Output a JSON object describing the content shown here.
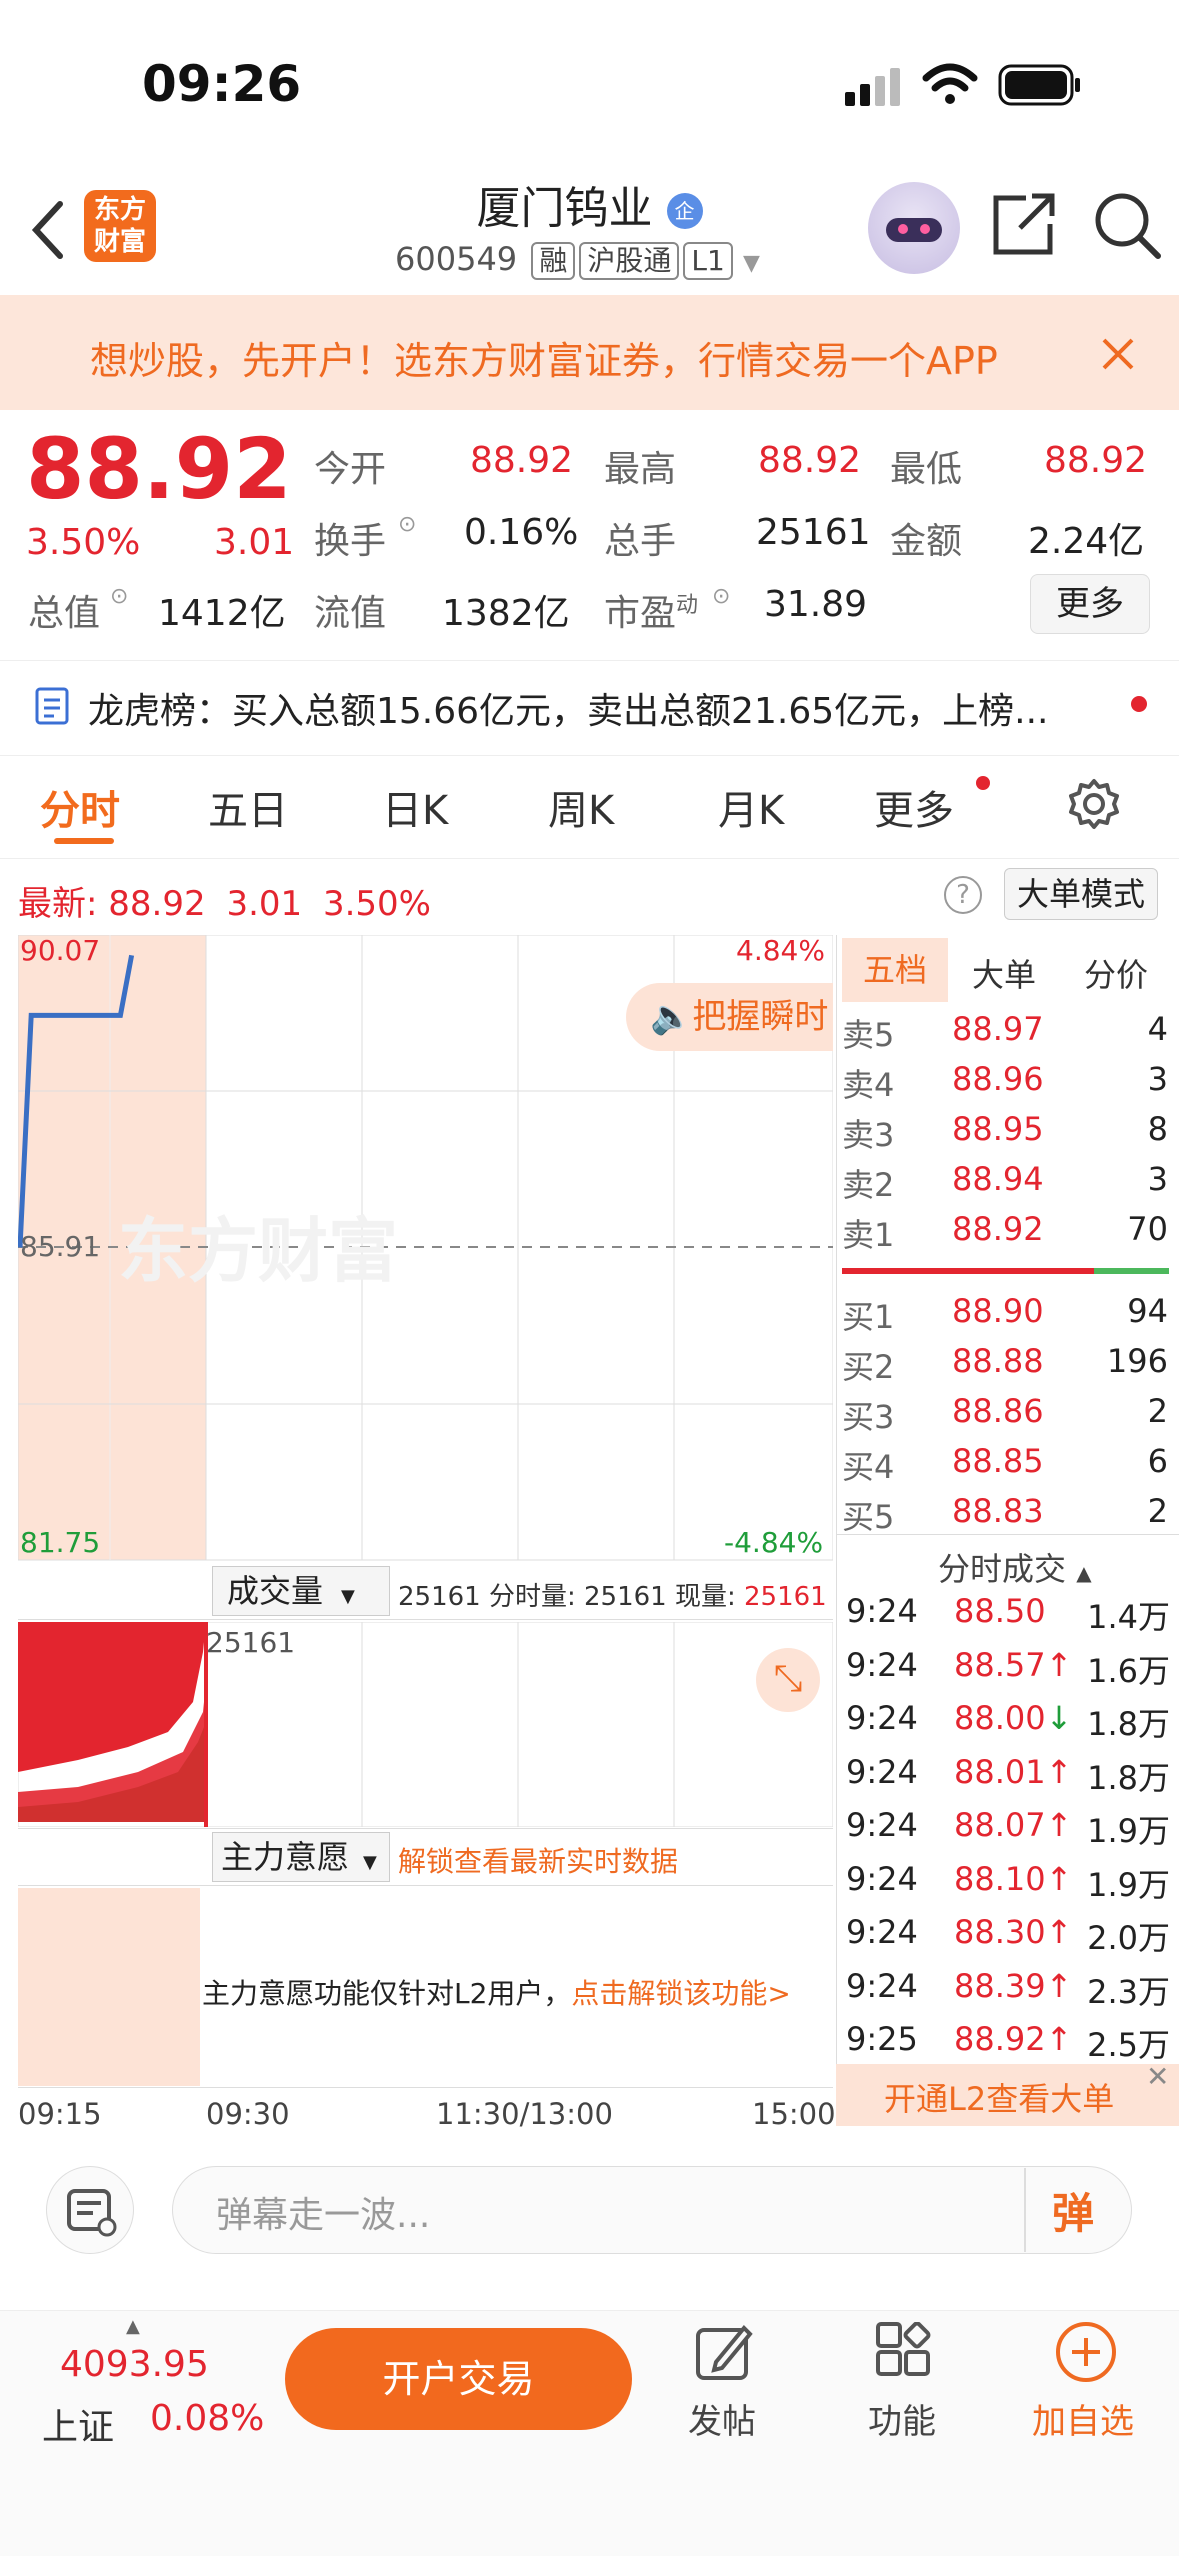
{
  "status_bar": {
    "time": "09:26"
  },
  "nav": {
    "logo_line1": "东方",
    "logo_line2": "财富",
    "title": "厦门钨业",
    "title_badge": "企",
    "code": "600549",
    "tags": [
      "融",
      "沪股通",
      "L1"
    ]
  },
  "banner": {
    "text": "想炒股，先开户！选东方财富证券，行情交易一个APP"
  },
  "quote": {
    "price": "88.92",
    "change_pct": "3.50%",
    "change": "3.01",
    "fields": [
      {
        "label": "今开",
        "value": "88.92"
      },
      {
        "label": "最高",
        "value": "88.92"
      },
      {
        "label": "最低",
        "value": "88.92"
      },
      {
        "label": "换手",
        "value": "0.16%"
      },
      {
        "label": "总手",
        "value": "25161"
      },
      {
        "label": "金额",
        "value": "2.24亿"
      },
      {
        "label": "总值",
        "value": "1412亿"
      },
      {
        "label": "流值",
        "value": "1382亿"
      },
      {
        "label": "市盈",
        "sup": "动",
        "value": "31.89"
      }
    ],
    "more_button": "更多"
  },
  "news": {
    "text": "龙虎榜：买入总额15.66亿元，卖出总额21.65亿元，上榜..."
  },
  "tabs": [
    "分时",
    "五日",
    "日K",
    "周K",
    "月K",
    "更多"
  ],
  "latest": {
    "label": "最新:",
    "price": "88.92",
    "change": "3.01",
    "pct": "3.50%",
    "big_order_mode": "大单模式"
  },
  "chart": {
    "y_top": "90.07",
    "y_mid": "85.91",
    "y_bottom": "81.75",
    "pct_top": "4.84%",
    "pct_bottom": "-4.84%",
    "watermark": "东方财富",
    "tip": "把握瞬时",
    "volume_selector": "成交量",
    "volume_info": "25161 分时量: 25161 现量:",
    "volume_now": "25161",
    "volume_axis": "25161",
    "intent_selector": "主力意愿",
    "intent_unlock": "解锁查看最新实时数据",
    "intent_msg": "主力意愿功能仅针对L2用户，",
    "intent_link": "点击解锁该功能>",
    "time_labels": [
      "09:15",
      "09:30",
      "11:30/13:00",
      "15:00"
    ]
  },
  "chart_data": {
    "type": "line",
    "x": [
      "09:15",
      "09:16",
      "09:17",
      "09:18",
      "09:19",
      "09:20",
      "09:21",
      "09:22",
      "09:23",
      "09:24",
      "09:25"
    ],
    "values": [
      85.91,
      89.0,
      89.0,
      89.0,
      89.0,
      89.0,
      89.0,
      89.0,
      89.0,
      89.0,
      89.8
    ],
    "ylim": [
      81.75,
      90.07
    ]
  },
  "orderbook": {
    "tabs": [
      "五档",
      "大单",
      "分价"
    ],
    "sells": [
      {
        "label": "卖5",
        "price": "88.97",
        "vol": "4"
      },
      {
        "label": "卖4",
        "price": "88.96",
        "vol": "3"
      },
      {
        "label": "卖3",
        "price": "88.95",
        "vol": "8"
      },
      {
        "label": "卖2",
        "price": "88.94",
        "vol": "3"
      },
      {
        "label": "卖1",
        "price": "88.92",
        "vol": "70"
      }
    ],
    "buys": [
      {
        "label": "买1",
        "price": "88.90",
        "vol": "94"
      },
      {
        "label": "买2",
        "price": "88.88",
        "vol": "196"
      },
      {
        "label": "买3",
        "price": "88.86",
        "vol": "2"
      },
      {
        "label": "买4",
        "price": "88.85",
        "vol": "6"
      },
      {
        "label": "买5",
        "price": "88.83",
        "vol": "2"
      }
    ],
    "trades_header": "分时成交",
    "trades": [
      {
        "time": "9:24",
        "price": "88.50",
        "vol": "1.4万",
        "dir": ""
      },
      {
        "time": "9:24",
        "price": "88.57↑",
        "vol": "1.6万",
        "dir": "up"
      },
      {
        "time": "9:24",
        "price": "88.00↓",
        "vol": "1.8万",
        "dir": "down"
      },
      {
        "time": "9:24",
        "price": "88.01↑",
        "vol": "1.8万",
        "dir": "up"
      },
      {
        "time": "9:24",
        "price": "88.07↑",
        "vol": "1.9万",
        "dir": "up"
      },
      {
        "time": "9:24",
        "price": "88.10↑",
        "vol": "1.9万",
        "dir": "up"
      },
      {
        "time": "9:24",
        "price": "88.30↑",
        "vol": "2.0万",
        "dir": "up"
      },
      {
        "time": "9:24",
        "price": "88.39↑",
        "vol": "2.3万",
        "dir": "up"
      },
      {
        "time": "9:25",
        "price": "88.92↑",
        "vol": "2.5万",
        "dir": "up"
      }
    ],
    "l2_banner": "开通L2查看大单"
  },
  "comment": {
    "placeholder": "弹幕走一波...",
    "danmu": "弹"
  },
  "bottom": {
    "index_value": "4093.95",
    "index_name": "上证",
    "index_pct": "0.08%",
    "open_button": "开户交易",
    "post": "发帖",
    "function": "功能",
    "add": "加自选"
  }
}
